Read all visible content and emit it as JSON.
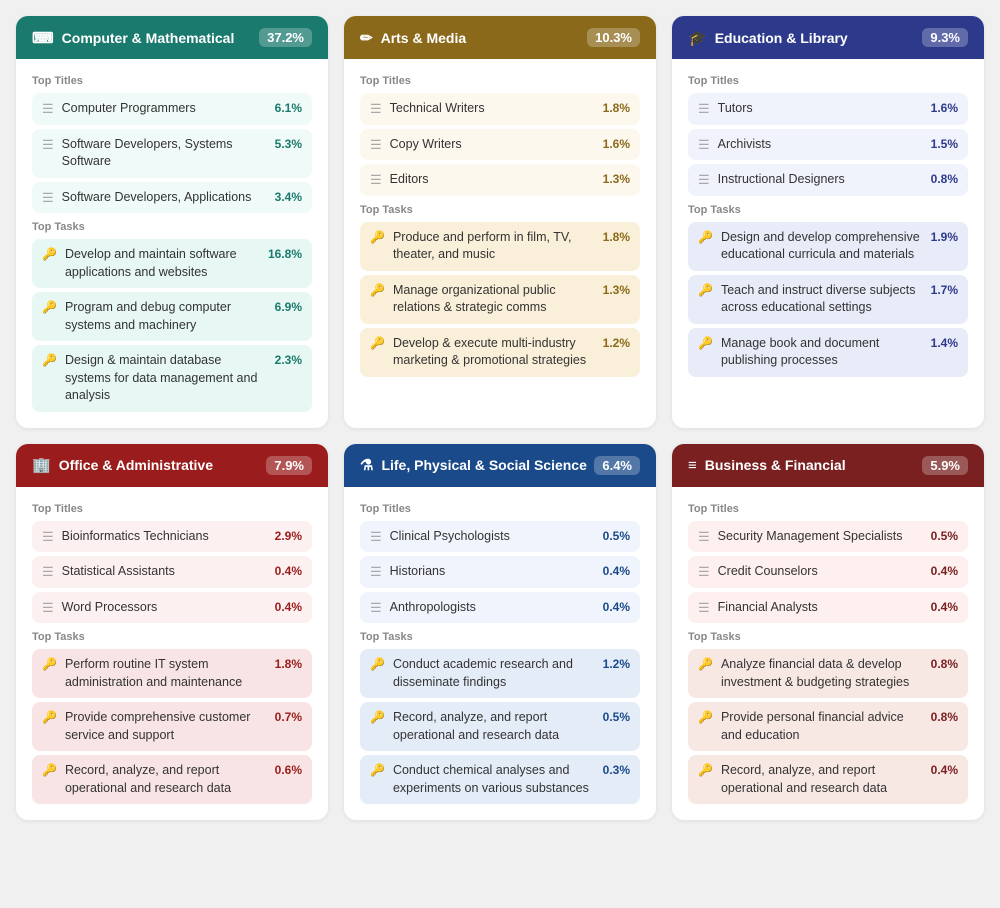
{
  "cards": [
    {
      "id": "computer-mathematical",
      "theme": "teal",
      "icon": "⌨",
      "title": "Computer & Mathematical",
      "percentage": "37.2%",
      "titles_label": "Top Titles",
      "titles": [
        {
          "icon": "▦",
          "text": "Computer Programmers",
          "pct": "6.1%"
        },
        {
          "icon": "▦",
          "text": "Software Developers, Systems Software",
          "pct": "5.3%"
        },
        {
          "icon": "▦",
          "text": "Software Developers, Applications",
          "pct": "3.4%"
        }
      ],
      "tasks_label": "Top Tasks",
      "tasks": [
        {
          "icon": "🔑",
          "text": "Develop and maintain software applications and websites",
          "pct": "16.8%"
        },
        {
          "icon": "🔑",
          "text": "Program and debug computer systems and machinery",
          "pct": "6.9%"
        },
        {
          "icon": "🔑",
          "text": "Design & maintain database systems for data management and analysis",
          "pct": "2.3%"
        }
      ]
    },
    {
      "id": "arts-media",
      "theme": "gold",
      "icon": "✏",
      "title": "Arts & Media",
      "percentage": "10.3%",
      "titles_label": "Top Titles",
      "titles": [
        {
          "icon": "▦",
          "text": "Technical Writers",
          "pct": "1.8%"
        },
        {
          "icon": "▦",
          "text": "Copy Writers",
          "pct": "1.6%"
        },
        {
          "icon": "▦",
          "text": "Editors",
          "pct": "1.3%"
        }
      ],
      "tasks_label": "Top Tasks",
      "tasks": [
        {
          "icon": "🔑",
          "text": "Produce and perform in film, TV, theater, and music",
          "pct": "1.8%"
        },
        {
          "icon": "🔑",
          "text": "Manage organizational public relations & strategic comms",
          "pct": "1.3%"
        },
        {
          "icon": "🔑",
          "text": "Develop & execute multi-industry marketing & promotional strategies",
          "pct": "1.2%"
        }
      ]
    },
    {
      "id": "education-library",
      "theme": "navy",
      "icon": "🎓",
      "title": "Education & Library",
      "percentage": "9.3%",
      "titles_label": "Top Titles",
      "titles": [
        {
          "icon": "▦",
          "text": "Tutors",
          "pct": "1.6%"
        },
        {
          "icon": "▦",
          "text": "Archivists",
          "pct": "1.5%"
        },
        {
          "icon": "▦",
          "text": "Instructional Designers",
          "pct": "0.8%"
        }
      ],
      "tasks_label": "Top Tasks",
      "tasks": [
        {
          "icon": "🔑",
          "text": "Design and develop comprehensive educational curricula and materials",
          "pct": "1.9%"
        },
        {
          "icon": "🔑",
          "text": "Teach and instruct diverse subjects across educational settings",
          "pct": "1.7%"
        },
        {
          "icon": "🔑",
          "text": "Manage book and document publishing processes",
          "pct": "1.4%"
        }
      ]
    },
    {
      "id": "office-administrative",
      "theme": "crimson",
      "icon": "🏢",
      "title": "Office & Administrative",
      "percentage": "7.9%",
      "titles_label": "Top Titles",
      "titles": [
        {
          "icon": "▦",
          "text": "Bioinformatics Technicians",
          "pct": "2.9%"
        },
        {
          "icon": "▦",
          "text": "Statistical Assistants",
          "pct": "0.4%"
        },
        {
          "icon": "▦",
          "text": "Word Processors",
          "pct": "0.4%"
        }
      ],
      "tasks_label": "Top Tasks",
      "tasks": [
        {
          "icon": "🔑",
          "text": "Perform routine IT system administration and maintenance",
          "pct": "1.8%"
        },
        {
          "icon": "🔑",
          "text": "Provide comprehensive customer service and support",
          "pct": "0.7%"
        },
        {
          "icon": "🔑",
          "text": "Record, analyze, and report operational and research data",
          "pct": "0.6%"
        }
      ]
    },
    {
      "id": "life-physical-social",
      "theme": "blue",
      "icon": "⚗",
      "title": "Life, Physical & Social Science",
      "percentage": "6.4%",
      "titles_label": "Top Titles",
      "titles": [
        {
          "icon": "▦",
          "text": "Clinical Psychologists",
          "pct": "0.5%"
        },
        {
          "icon": "▦",
          "text": "Historians",
          "pct": "0.4%"
        },
        {
          "icon": "▦",
          "text": "Anthropologists",
          "pct": "0.4%"
        }
      ],
      "tasks_label": "Top Tasks",
      "tasks": [
        {
          "icon": "🔑",
          "text": "Conduct academic research and disseminate findings",
          "pct": "1.2%"
        },
        {
          "icon": "🔑",
          "text": "Record, analyze, and report operational and research data",
          "pct": "0.5%"
        },
        {
          "icon": "🔑",
          "text": "Conduct chemical analyses and experiments on various substances",
          "pct": "0.3%"
        }
      ]
    },
    {
      "id": "business-financial",
      "theme": "darkred",
      "icon": "≡",
      "title": "Business & Financial",
      "percentage": "5.9%",
      "titles_label": "Top Titles",
      "titles": [
        {
          "icon": "▦",
          "text": "Security Management Specialists",
          "pct": "0.5%"
        },
        {
          "icon": "▦",
          "text": "Credit Counselors",
          "pct": "0.4%"
        },
        {
          "icon": "▦",
          "text": "Financial Analysts",
          "pct": "0.4%"
        }
      ],
      "tasks_label": "Top Tasks",
      "tasks": [
        {
          "icon": "🔑",
          "text": "Analyze financial data & develop investment & budgeting strategies",
          "pct": "0.8%"
        },
        {
          "icon": "🔑",
          "text": "Provide personal financial advice and education",
          "pct": "0.8%"
        },
        {
          "icon": "🔑",
          "text": "Record, analyze, and report operational and research data",
          "pct": "0.4%"
        }
      ]
    }
  ]
}
